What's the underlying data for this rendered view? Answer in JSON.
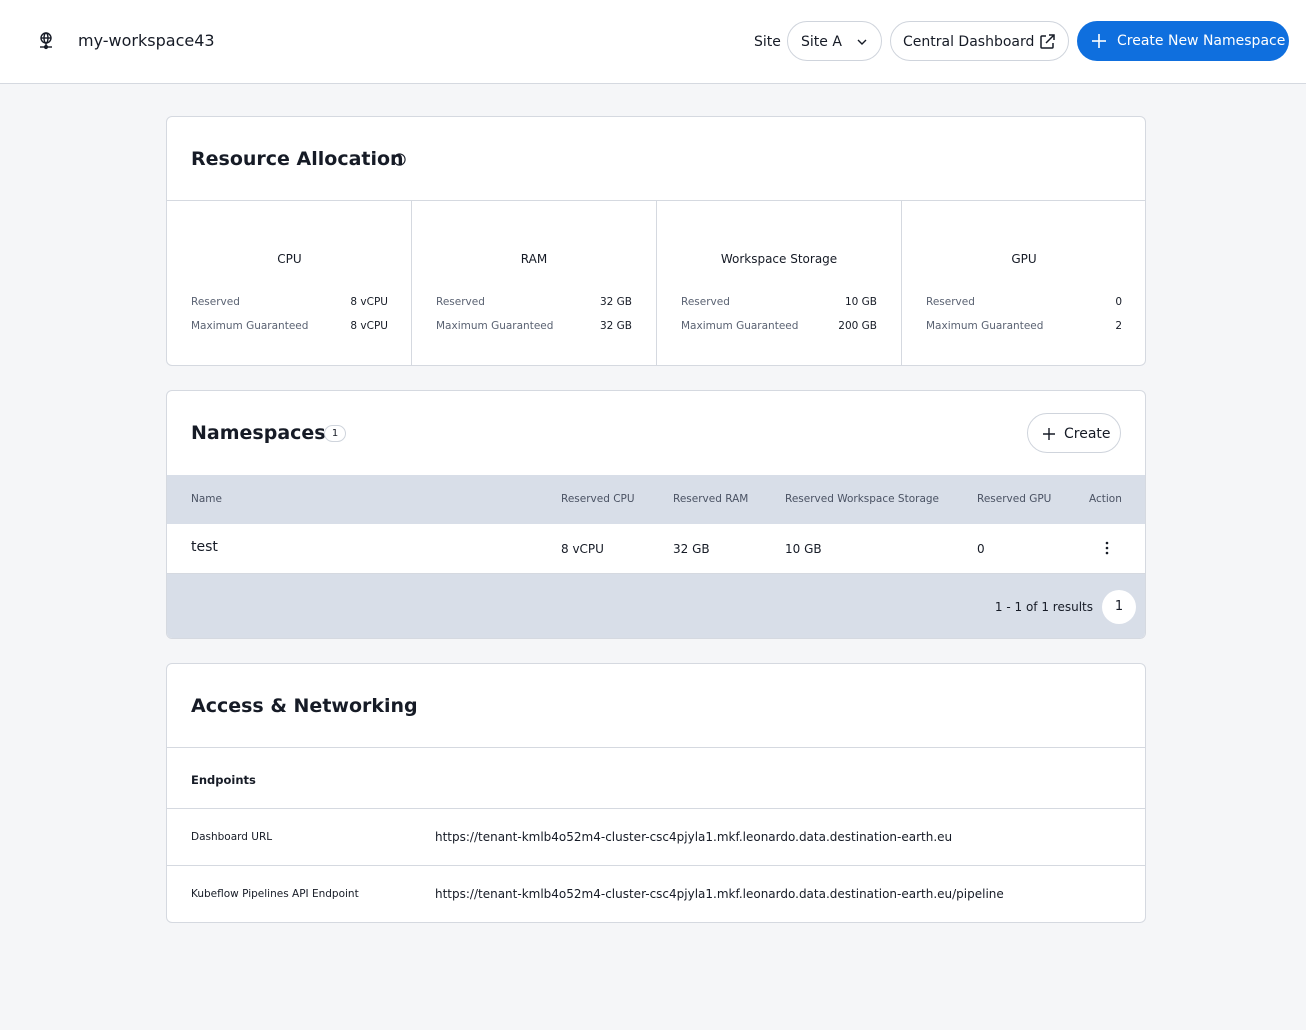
{
  "header": {
    "workspace_name": "my-workspace43",
    "site_label": "Site",
    "site_value": "Site A",
    "central_dashboard_label": "Central Dashboard",
    "create_namespace_label": "Create New Namespace"
  },
  "resource_allocation": {
    "title": "Resource Allocation",
    "columns": [
      {
        "title": "CPU",
        "reserved_label": "Reserved",
        "reserved": "8 vCPU",
        "max_label": "Maximum Guaranteed",
        "max": "8 vCPU"
      },
      {
        "title": "RAM",
        "reserved_label": "Reserved",
        "reserved": "32 GB",
        "max_label": "Maximum Guaranteed",
        "max": "32 GB"
      },
      {
        "title": "Workspace Storage",
        "reserved_label": "Reserved",
        "reserved": "10 GB",
        "max_label": "Maximum Guaranteed",
        "max": "200 GB"
      },
      {
        "title": "GPU",
        "reserved_label": "Reserved",
        "reserved": "0",
        "max_label": "Maximum Guaranteed",
        "max": "2"
      }
    ]
  },
  "namespaces": {
    "title": "Namespaces",
    "count": "1",
    "create_label": "Create",
    "headers": [
      "Name",
      "Reserved CPU",
      "Reserved RAM",
      "Reserved Workspace Storage",
      "Reserved GPU",
      "Action"
    ],
    "rows": [
      {
        "name": "test",
        "cpu": "8 vCPU",
        "ram": "32 GB",
        "storage": "10 GB",
        "gpu": "0"
      }
    ],
    "results_text": "1 - 1 of 1 results",
    "current_page": "1"
  },
  "access": {
    "title": "Access & Networking",
    "endpoints_heading": "Endpoints",
    "endpoints": [
      {
        "label": "Dashboard URL",
        "value": "https://tenant-kmlb4o52m4-cluster-csc4pjyla1.mkf.leonardo.data.destination-earth.eu"
      },
      {
        "label": "Kubeflow Pipelines API Endpoint",
        "value": "https://tenant-kmlb4o52m4-cluster-csc4pjyla1.mkf.leonardo.data.destination-earth.eu/pipeline"
      }
    ]
  },
  "colors": {
    "primary": "#0f6fde",
    "table_header_bg": "#d8dee8",
    "page_bg": "#f5f6f8"
  },
  "icons": [
    "workspace-globe-icon",
    "chevron-down-icon",
    "external-link-icon",
    "plus-icon",
    "info-icon",
    "kebab-menu-icon"
  ]
}
